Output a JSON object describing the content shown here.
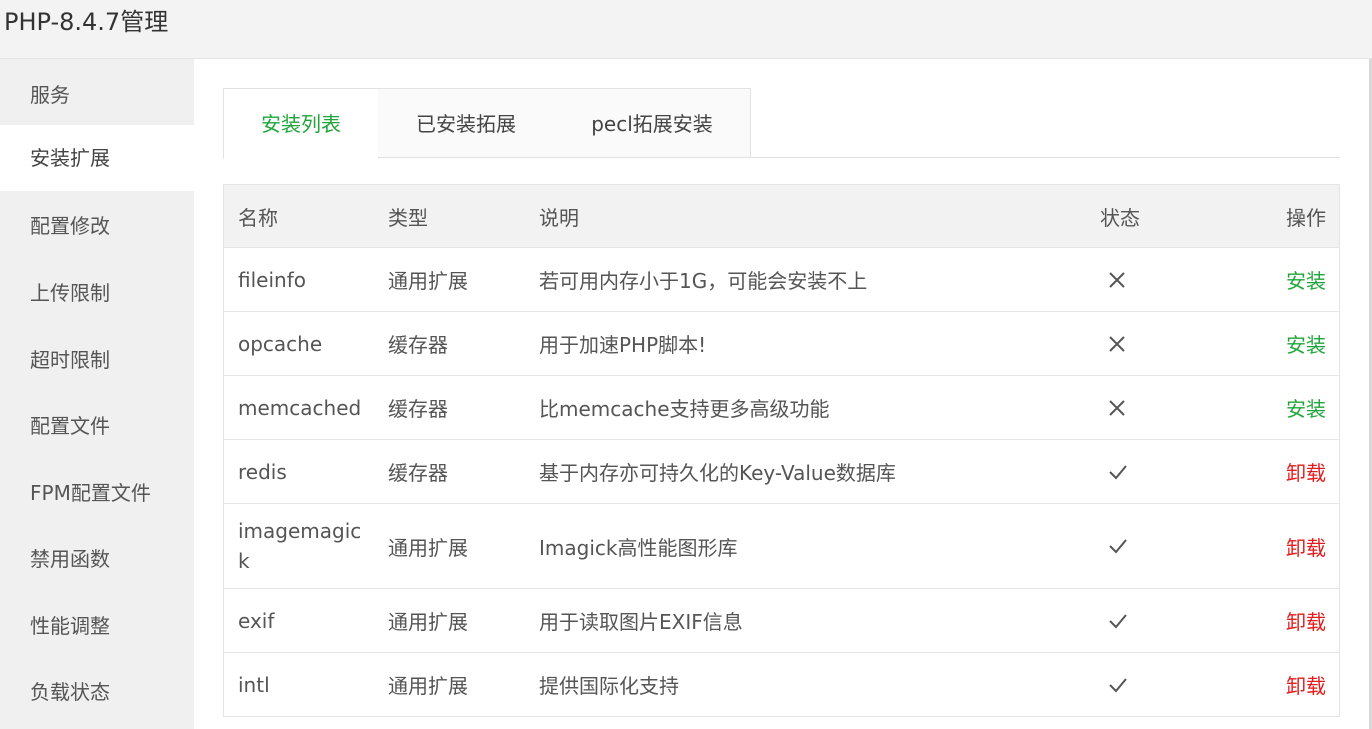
{
  "window": {
    "title": "PHP-8.4.7管理"
  },
  "sidebar": {
    "items": [
      {
        "label": "服务",
        "active": false
      },
      {
        "label": "安装扩展",
        "active": true
      },
      {
        "label": "配置修改",
        "active": false
      },
      {
        "label": "上传限制",
        "active": false
      },
      {
        "label": "超时限制",
        "active": false
      },
      {
        "label": "配置文件",
        "active": false
      },
      {
        "label": "FPM配置文件",
        "active": false
      },
      {
        "label": "禁用函数",
        "active": false
      },
      {
        "label": "性能调整",
        "active": false
      },
      {
        "label": "负载状态",
        "active": false
      }
    ]
  },
  "tabs": [
    {
      "label": "安装列表",
      "active": true
    },
    {
      "label": "已安装拓展",
      "active": false
    },
    {
      "label": "pecl拓展安装",
      "active": false
    }
  ],
  "table": {
    "headers": {
      "name": "名称",
      "type": "类型",
      "desc": "说明",
      "status": "状态",
      "op": "操作"
    },
    "rows": [
      {
        "name": "fileinfo",
        "type": "通用扩展",
        "desc": "若可用内存小于1G，可能会安装不上",
        "installed": false,
        "status_icon": "cross-icon",
        "op": "安装"
      },
      {
        "name": "opcache",
        "type": "缓存器",
        "desc": "用于加速PHP脚本!",
        "installed": false,
        "status_icon": "cross-icon",
        "op": "安装"
      },
      {
        "name": "memcached",
        "type": "缓存器",
        "desc": "比memcache支持更多高级功能",
        "installed": false,
        "status_icon": "cross-icon",
        "op": "安装"
      },
      {
        "name": "redis",
        "type": "缓存器",
        "desc": "基于内存亦可持久化的Key-Value数据库",
        "installed": true,
        "status_icon": "check-icon",
        "op": "卸载"
      },
      {
        "name": "imagemagick",
        "type": "通用扩展",
        "desc": "Imagick高性能图形库",
        "installed": true,
        "status_icon": "check-icon",
        "op": "卸载"
      },
      {
        "name": "exif",
        "type": "通用扩展",
        "desc": "用于读取图片EXIF信息",
        "installed": true,
        "status_icon": "check-icon",
        "op": "卸载"
      },
      {
        "name": "intl",
        "type": "通用扩展",
        "desc": "提供国际化支持",
        "installed": true,
        "status_icon": "check-icon",
        "op": "卸载"
      }
    ]
  },
  "colors": {
    "accent_green": "#20a53a",
    "danger_red": "#e11d1d"
  }
}
